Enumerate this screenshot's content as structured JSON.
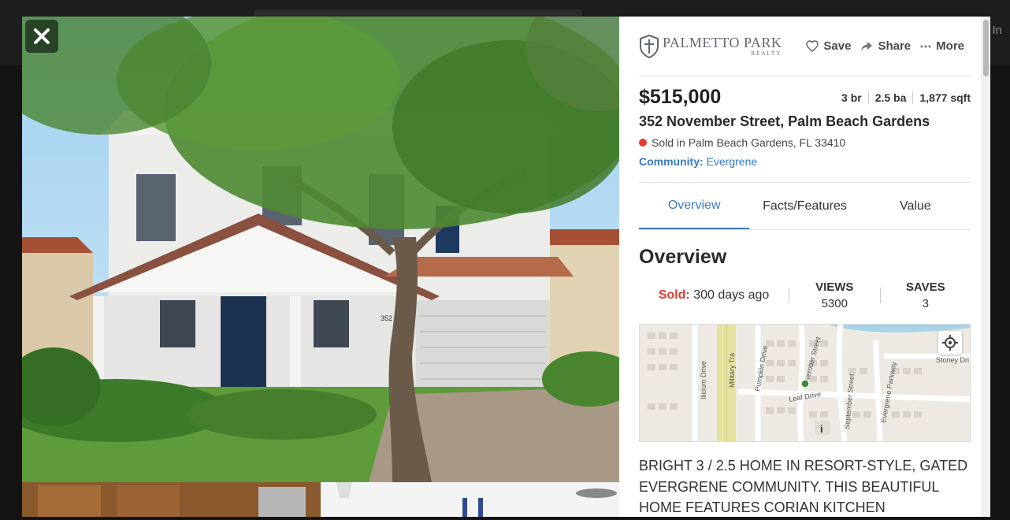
{
  "background": {
    "sign_in": "In"
  },
  "gallery": {
    "close_label": "✕"
  },
  "brand": {
    "name": "PALMETTO PARK",
    "sub": "REALTY"
  },
  "actions": {
    "save": "Save",
    "share": "Share",
    "more": "More"
  },
  "listing": {
    "price": "$515,000",
    "beds": "3 br",
    "baths": "2.5 ba",
    "sqft": "1,877 sqft",
    "address": "352 November Street, Palm Beach Gardens",
    "status_line": "Sold in Palm Beach Gardens, FL 33410",
    "community_label": "Community:",
    "community_value": "Evergrene"
  },
  "tabs": [
    {
      "label": "Overview",
      "active": true
    },
    {
      "label": "Facts/Features",
      "active": false
    },
    {
      "label": "Value",
      "active": false
    }
  ],
  "overview": {
    "title": "Overview",
    "sold_label": "Sold:",
    "sold_value": "300 days ago",
    "views_label": "VIEWS",
    "views_value": "5300",
    "saves_label": "SAVES",
    "saves_value": "3"
  },
  "map": {
    "streets": [
      "Military Tra",
      "Pumpkin Drive",
      "November Street",
      "September Street",
      "Evergrene Parkway",
      "Leaf Drive",
      "Stoney Dri",
      "Ilicium Drive"
    ]
  },
  "description": "BRIGHT 3 / 2.5 HOME IN RESORT-STYLE, GATED EVERGRENE COMMUNITY. THIS BEAUTIFUL HOME FEATURES CORIAN KITCHEN",
  "colors": {
    "accent": "#3a7ac4",
    "sold": "#e53935",
    "dark_overlay": "#161616"
  }
}
